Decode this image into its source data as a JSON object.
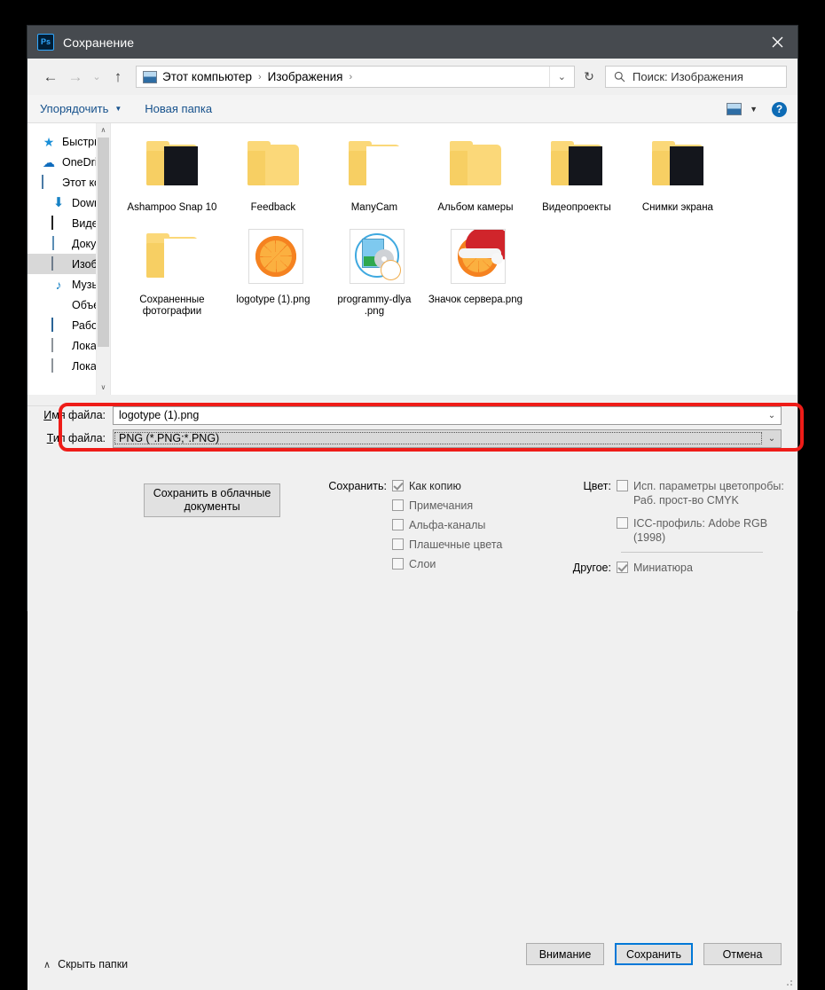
{
  "window": {
    "app_icon": "Ps",
    "title": "Сохранение",
    "close_icon": "close-icon"
  },
  "nav": {
    "back_icon": "arrow-left-icon",
    "forward_icon": "arrow-right-icon",
    "recent_icon": "chevron-down-icon",
    "up_icon": "arrow-up-icon",
    "address_icon": "pictures-icon",
    "breadcrumbs": [
      "Этот компьютер",
      "Изображения"
    ],
    "separator": "›",
    "dropdown_icon": "chevron-down-icon",
    "refresh_icon": "refresh-icon",
    "search_icon": "search-icon",
    "search_placeholder": "Поиск: Изображения"
  },
  "toolbar": {
    "organize_label": "Упорядочить",
    "organize_caret": "▼",
    "new_folder_label": "Новая папка",
    "view_icon": "view-layout-icon",
    "view_caret": "▼",
    "help_label": "?"
  },
  "sidebar": {
    "items": [
      {
        "label": "Быстрый доступ",
        "icon": "star-icon",
        "indent": false,
        "selected": false
      },
      {
        "label": "OneDrive",
        "icon": "cloud-icon",
        "indent": false,
        "selected": false
      },
      {
        "label": "Этот компьютер",
        "icon": "computer-icon",
        "indent": false,
        "selected": false
      },
      {
        "label": "Downloads",
        "icon": "download-icon",
        "indent": true,
        "selected": false
      },
      {
        "label": "Видео",
        "icon": "video-icon",
        "indent": true,
        "selected": false
      },
      {
        "label": "Документы",
        "icon": "documents-icon",
        "indent": true,
        "selected": false
      },
      {
        "label": "Изображения",
        "icon": "pictures-icon",
        "indent": true,
        "selected": true
      },
      {
        "label": "Музыка",
        "icon": "music-icon",
        "indent": true,
        "selected": false
      },
      {
        "label": "Объемные объ",
        "icon": "3d-objects-icon",
        "indent": true,
        "selected": false
      },
      {
        "label": "Рабочий стол",
        "icon": "desktop-icon",
        "indent": true,
        "selected": false
      },
      {
        "label": "Локальный дис",
        "icon": "disk-icon",
        "indent": true,
        "selected": false
      },
      {
        "label": "Локальный дис",
        "icon": "disk-icon",
        "indent": true,
        "selected": false
      }
    ],
    "scroll_up_icon": "chevron-up-icon",
    "scroll_down_icon": "chevron-down-icon"
  },
  "files": [
    {
      "name": "Ashampoo Snap 10",
      "type": "folder",
      "preview": "dark"
    },
    {
      "name": "Feedback",
      "type": "folder",
      "preview": "none"
    },
    {
      "name": "ManyCam",
      "type": "folder",
      "preview": "light"
    },
    {
      "name": "Альбом камеры",
      "type": "folder",
      "preview": "none"
    },
    {
      "name": "Видеопроекты",
      "type": "folder",
      "preview": "dark"
    },
    {
      "name": "Снимки экрана",
      "type": "folder",
      "preview": "dark"
    },
    {
      "name": "Сохраненные фотографии",
      "type": "folder",
      "preview": "light"
    },
    {
      "name": "logotype (1).png",
      "type": "image",
      "preview": "orange"
    },
    {
      "name": "programmy-dlya .png",
      "type": "image",
      "preview": "program"
    },
    {
      "name": "Значок сервера.png",
      "type": "image",
      "preview": "orange-santa"
    }
  ],
  "form": {
    "filename_label": "Имя файла:",
    "filename_label_accel": "И",
    "filename_value": "logotype (1).png",
    "filetype_label": "Тип файла:",
    "filetype_label_accel": "Т",
    "filetype_value": "PNG (*.PNG;*.PNG)",
    "dropdown_icon": "chevron-down-icon",
    "highlight_color": "#ee1c18"
  },
  "cloud_button": {
    "label": "Сохранить в облачные документы"
  },
  "options": {
    "save_group_label": "Сохранить:",
    "save_items": [
      {
        "label": "Как копию",
        "checked": true
      },
      {
        "label": "Примечания",
        "checked": false
      },
      {
        "label": "Альфа-каналы",
        "checked": false
      },
      {
        "label": "Плашечные цвета",
        "checked": false
      },
      {
        "label": "Слои",
        "checked": false
      }
    ],
    "color_group_label": "Цвет:",
    "color_items": [
      {
        "label": "Исп. параметры цветопробы:  Раб. прост-во CMYK",
        "checked": false
      },
      {
        "label": "ICC-профиль:  Adobe RGB (1998)",
        "checked": false
      }
    ],
    "other_group_label": "Другое:",
    "other_items": [
      {
        "label": "Миниатюра",
        "checked": true
      }
    ]
  },
  "buttons": {
    "warning_label": "Внимание",
    "save_label": "Сохранить",
    "cancel_label": "Отмена"
  },
  "footer": {
    "hide_folders_label": "Скрыть папки",
    "hide_folders_icon": "chevron-up-icon"
  }
}
